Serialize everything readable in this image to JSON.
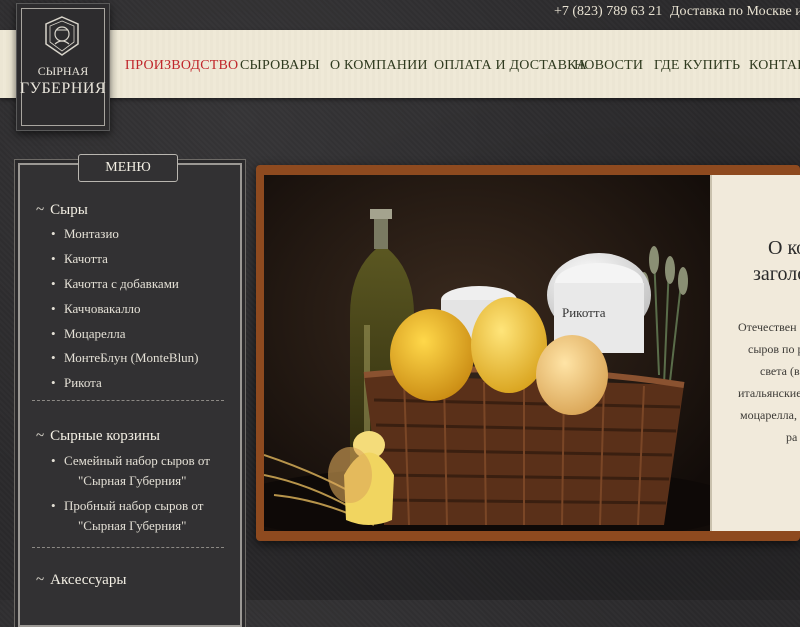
{
  "topbar": {
    "phone": "+7 (823) 789 63 21",
    "delivery": "Доставка по Москве и Мо"
  },
  "logo": {
    "line1": "СЫРНАЯ",
    "line2": "ГУБЕРНИЯ"
  },
  "nav": {
    "items": [
      {
        "label": "ПРОИЗВОДСТВО",
        "active": true
      },
      {
        "label": "СЫРОВАРЫ",
        "active": false
      },
      {
        "label": "О КОМПАНИИ",
        "active": false
      },
      {
        "label": "ОПЛАТА И ДОСТАВКА",
        "active": false
      },
      {
        "label": "НОВОСТИ",
        "active": false
      },
      {
        "label": "ГДЕ КУПИТЬ",
        "active": false
      },
      {
        "label": "КОНТАКТ",
        "active": false
      }
    ],
    "active_color": "#c0262b",
    "text_color": "#2f3a1f"
  },
  "sidebar": {
    "title": "МЕНЮ",
    "categories": [
      {
        "label": "Сыры",
        "items": [
          "Монтазио",
          "Качотта",
          "Качотта с добавками",
          "Каччовакалло",
          "Моцарелла",
          "МонтеБлун (MonteBlun)",
          "Рикота"
        ]
      },
      {
        "label": "Сырные корзины",
        "items": [
          [
            "Семейный набор сыров от",
            "\"Сырная Губерния\""
          ],
          [
            "Пробный набор сыров от",
            "\"Сырная Губерния\""
          ]
        ]
      },
      {
        "label": "Аксессуары",
        "items": []
      }
    ]
  },
  "banner": {
    "photo_label": "Рикотта",
    "heading_line1": "О ко",
    "heading_line2": "заголо",
    "text_lines": [
      "Отечествен",
      "сыров по р",
      "света (в",
      "итальянские",
      "моцарелла,",
      "ра"
    ]
  },
  "colors": {
    "background": "#2b2a2c",
    "navbar": "#efe9d6",
    "banner_frame": "#8e4a1f"
  }
}
